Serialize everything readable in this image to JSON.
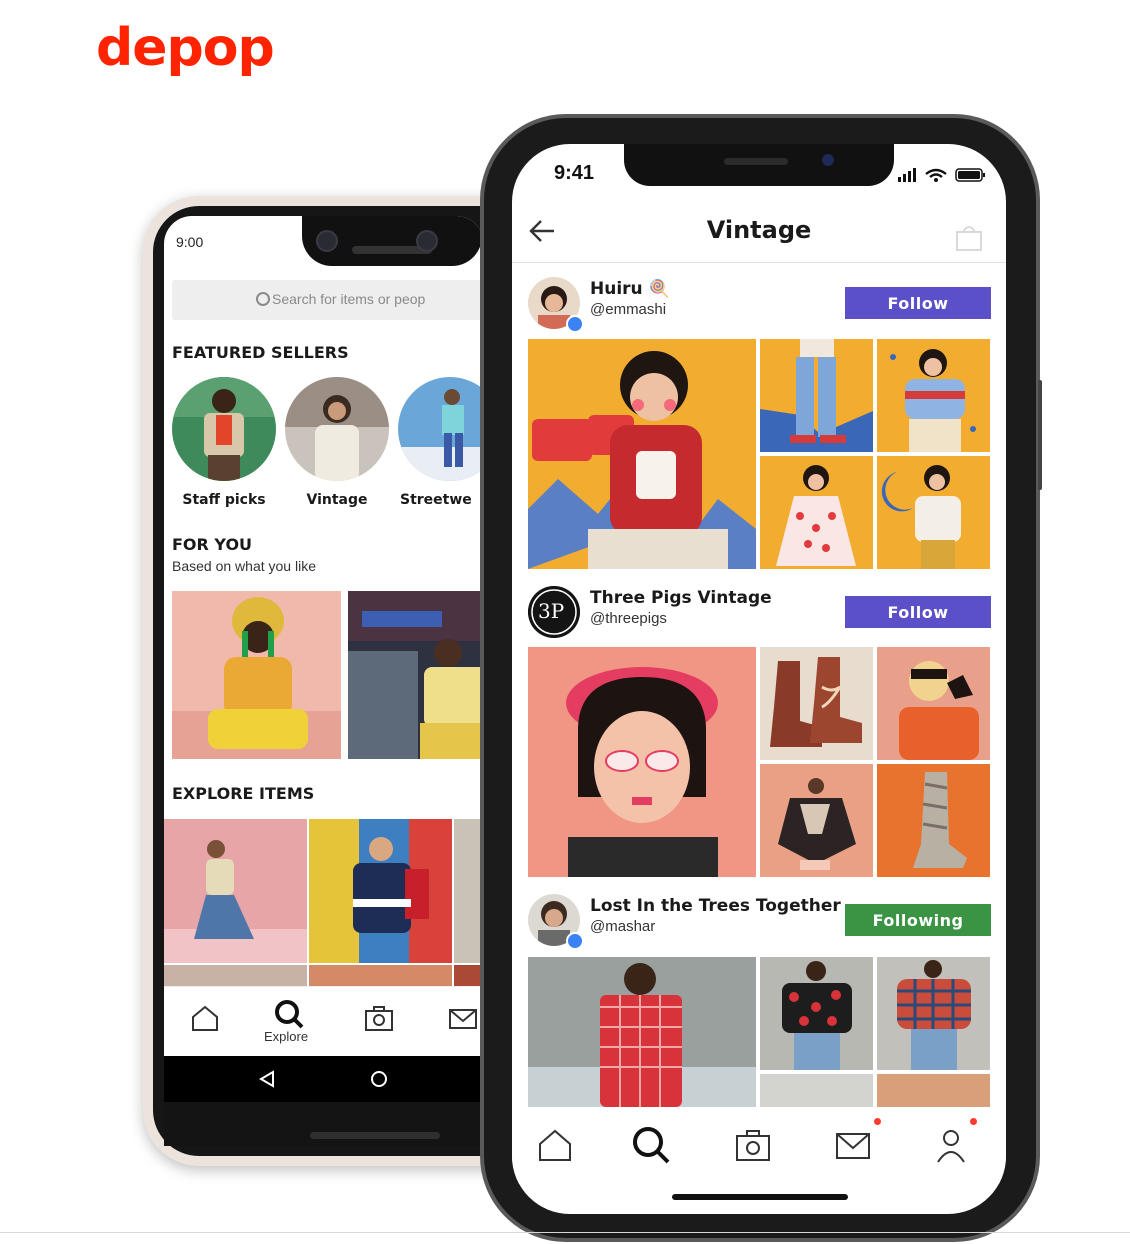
{
  "brand": {
    "logo": "depop"
  },
  "android": {
    "time": "9:00",
    "search_placeholder": "Search for items or peop",
    "featured_title": "FEATURED SELLERS",
    "featured": [
      {
        "label": "Staff picks"
      },
      {
        "label": "Vintage"
      },
      {
        "label": "Streetwe"
      }
    ],
    "for_you_title": "FOR YOU",
    "for_you_sub": "Based on what you like",
    "explore_title": "EXPLORE ITEMS",
    "nav": {
      "explore_label": "Explore"
    }
  },
  "iphone": {
    "time": "9:41",
    "header_title": "Vintage",
    "posts": [
      {
        "name": "Huiru 🍭",
        "handle": "@emmashi",
        "button": "Follow",
        "button_state": "follow"
      },
      {
        "name": "Three Pigs Vintage",
        "handle": "@threepigs",
        "button": "Follow",
        "button_state": "follow"
      },
      {
        "name": "Lost In the Trees Together",
        "handle": "@mashar",
        "button": "Following",
        "button_state": "following"
      }
    ],
    "nav_icons": [
      "home-icon",
      "search-icon",
      "camera-icon",
      "mail-icon",
      "profile-icon"
    ]
  },
  "colors": {
    "brand_red": "#ff2300",
    "follow_purple": "#5c50c8",
    "following_green": "#3a9443"
  }
}
